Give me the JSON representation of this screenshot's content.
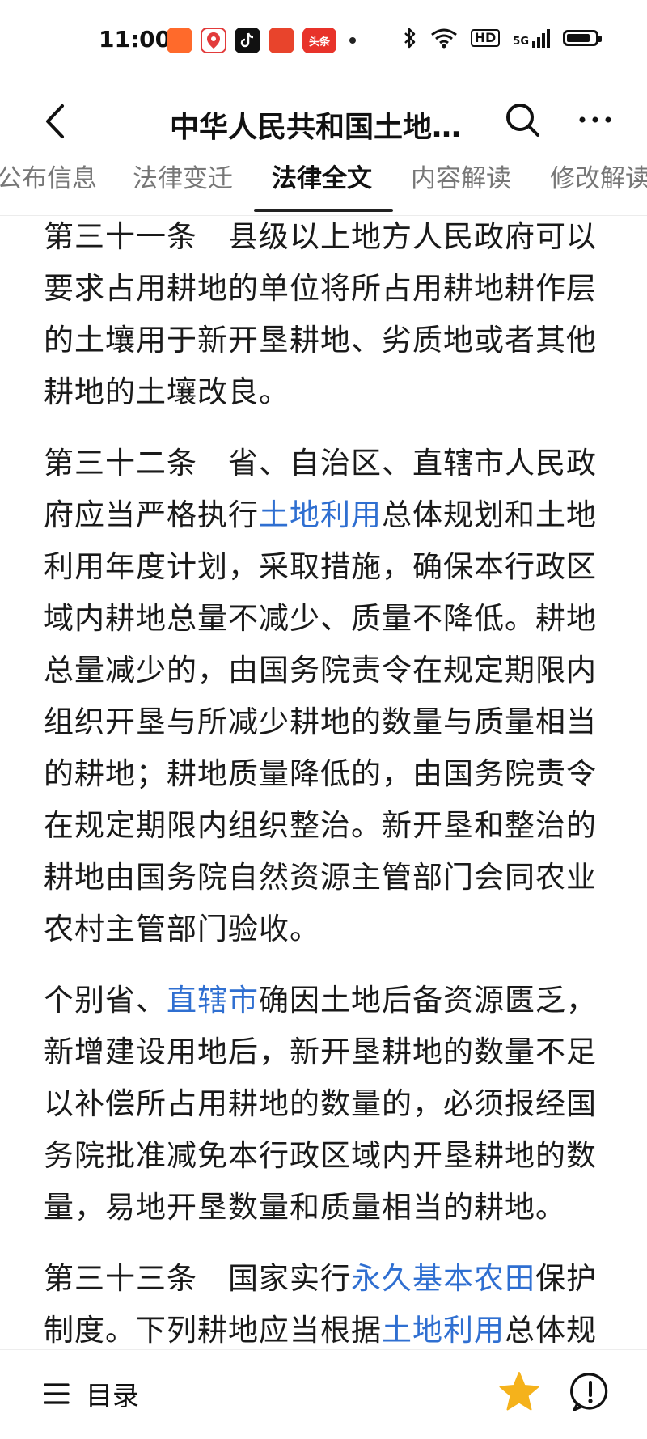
{
  "status_bar": {
    "time": "11:00",
    "app_icon_labels": [
      "",
      "",
      "",
      "",
      "头条"
    ],
    "hd_label": "HD",
    "network_label": "5G",
    "battery_level": 0.85
  },
  "nav": {
    "title": "中华人民共和国土地…"
  },
  "tabs": [
    {
      "label": "公布信息"
    },
    {
      "label": "法律变迁"
    },
    {
      "label": "法律全文"
    },
    {
      "label": "内容解读"
    },
    {
      "label": "修改解读"
    }
  ],
  "article": {
    "p1": "第三十一条　县级以上地方人民政府可以要求占用耕地的单位将所占用耕地耕作层的土壤用于新开垦耕地、劣质地或者其他耕地的土壤改良。",
    "p2": {
      "pre": "第三十二条　省、自治区、直辖市人民政府应当严格执行",
      "link": "土地利用",
      "post": "总体规划和土地利用年度计划，采取措施，确保本行政区域内耕地总量不减少、质量不降低。耕地总量减少的，由国务院责令在规定期限内组织开垦与所减少耕地的数量与质量相当的耕地；耕地质量降低的，由国务院责令在规定期限内组织整治。新开垦和整治的耕地由国务院自然资源主管部门会同农业农村主管部门验收。"
    },
    "p3": {
      "pre": "个别省、",
      "link": "直辖市",
      "post": "确因土地后备资源匮乏，新增建设用地后，新开垦耕地的数量不足以补偿所占用耕地的数量的，必须报经国务院批准减免本行政区域内开垦耕地的数量，易地开垦数量和质量相当的耕地。"
    },
    "p4": {
      "pre": "第三十三条　国家实行",
      "link1": "永久基本农田",
      "mid": "保护制度。下列耕地应当根据",
      "link2": "土地利用",
      "post": "总体规"
    }
  },
  "bottom": {
    "toc_label": "目录"
  },
  "colors": {
    "link": "#2f6fd1",
    "star": "#f5b21b"
  }
}
